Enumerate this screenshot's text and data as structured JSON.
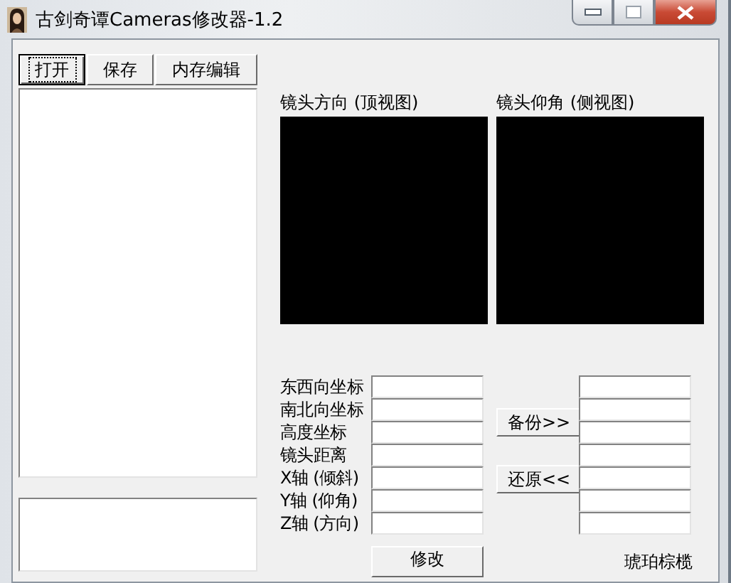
{
  "window": {
    "title": "古剑奇谭Cameras修改器-1.2"
  },
  "toolbar": [
    {
      "label": "打开",
      "focused": true
    },
    {
      "label": "保存",
      "focused": false
    },
    {
      "label": "内存编辑",
      "focused": false
    }
  ],
  "views": [
    {
      "title": "镜头方向 (顶视图)"
    },
    {
      "title": "镜头仰角 (侧视图)"
    }
  ],
  "fields": [
    {
      "label": "东西向坐标"
    },
    {
      "label": "南北向坐标"
    },
    {
      "label": "高度坐标"
    },
    {
      "label": "镜头距离"
    },
    {
      "label": "X轴 (倾斜)"
    },
    {
      "label": "Y轴 (仰角)"
    },
    {
      "label": "Z轴 (方向)"
    }
  ],
  "actions": [
    "备份>>",
    "还原<<"
  ],
  "apply_button": "修改",
  "footer_text": "琥珀棕榄"
}
